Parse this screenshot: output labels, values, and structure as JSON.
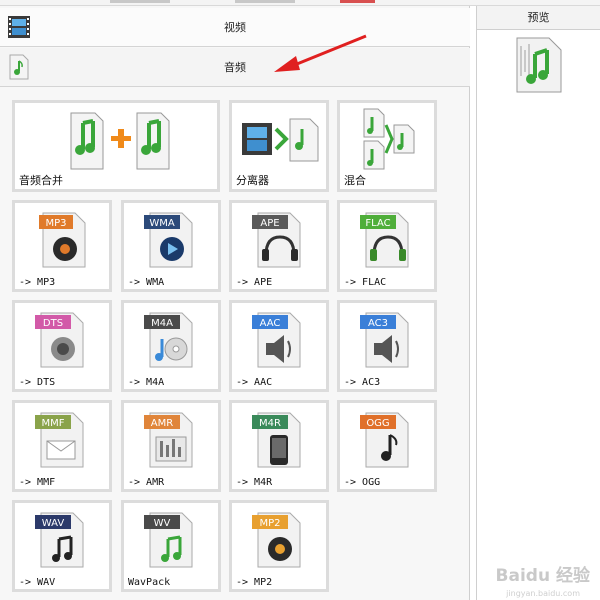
{
  "categories": {
    "video": {
      "label": "视频"
    },
    "audio": {
      "label": "音频"
    }
  },
  "preview": {
    "label": "预览"
  },
  "tiles": [
    {
      "label": "音频合并"
    },
    {
      "label": "分离器"
    },
    {
      "label": "混合"
    },
    {
      "label": "-> MP3",
      "badge": "MP3",
      "badge_color": "#e07a2a"
    },
    {
      "label": "-> WMA",
      "badge": "WMA",
      "badge_color": "#2c4a7a"
    },
    {
      "label": "-> APE",
      "badge": "APE",
      "badge_color": "#5a5a5a"
    },
    {
      "label": "-> FLAC",
      "badge": "FLAC",
      "badge_color": "#4fae3a"
    },
    {
      "label": "-> DTS",
      "badge": "DTS",
      "badge_color": "#d25aa8"
    },
    {
      "label": "-> M4A",
      "badge": "M4A",
      "badge_color": "#4a4a4a"
    },
    {
      "label": "-> AAC",
      "badge": "AAC",
      "badge_color": "#3a7fd8"
    },
    {
      "label": "-> AC3",
      "badge": "AC3",
      "badge_color": "#3a7fd8"
    },
    {
      "label": "-> MMF",
      "badge": "MMF",
      "badge_color": "#8aa34a"
    },
    {
      "label": "-> AMR",
      "badge": "AMR",
      "badge_color": "#e0853a"
    },
    {
      "label": "-> M4R",
      "badge": "M4R",
      "badge_color": "#3a8a5a"
    },
    {
      "label": "-> OGG",
      "badge": "OGG",
      "badge_color": "#e0702a"
    },
    {
      "label": "-> WAV",
      "badge": "WAV",
      "badge_color": "#2c3a6a"
    },
    {
      "label": "WavPack",
      "badge": "WV",
      "badge_color": "#4a4a4a"
    },
    {
      "label": "-> MP2",
      "badge": "MP2",
      "badge_color": "#e8a030"
    }
  ],
  "watermark": {
    "text": "Baidu 经验",
    "sub": "jingyan.baidu.com"
  }
}
